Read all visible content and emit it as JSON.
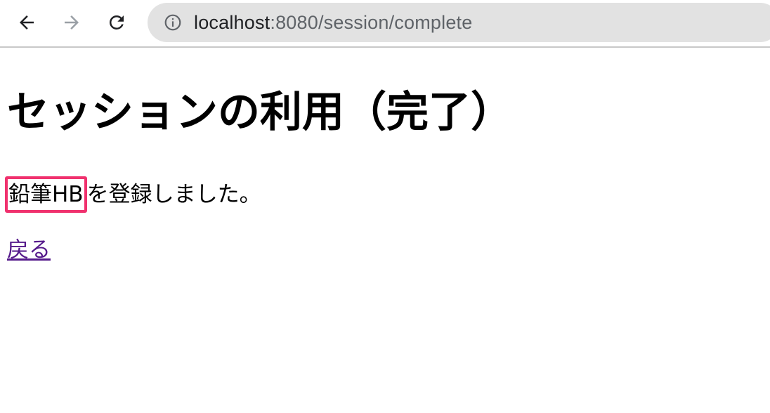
{
  "browser": {
    "url_host": "localhost",
    "url_path": ":8080/session/complete",
    "icons": [
      "back-arrow-icon",
      "forward-arrow-icon",
      "reload-icon",
      "info-icon"
    ]
  },
  "page": {
    "title": "セッションの利用（完了）",
    "message_item": "鉛筆HB",
    "message_rest": "を登録しました。",
    "back_link": "戻る"
  },
  "colors": {
    "highlight_border": "#f0316e",
    "visited_link": "#551a8b",
    "omnibox_bg": "#e2e2e2"
  }
}
